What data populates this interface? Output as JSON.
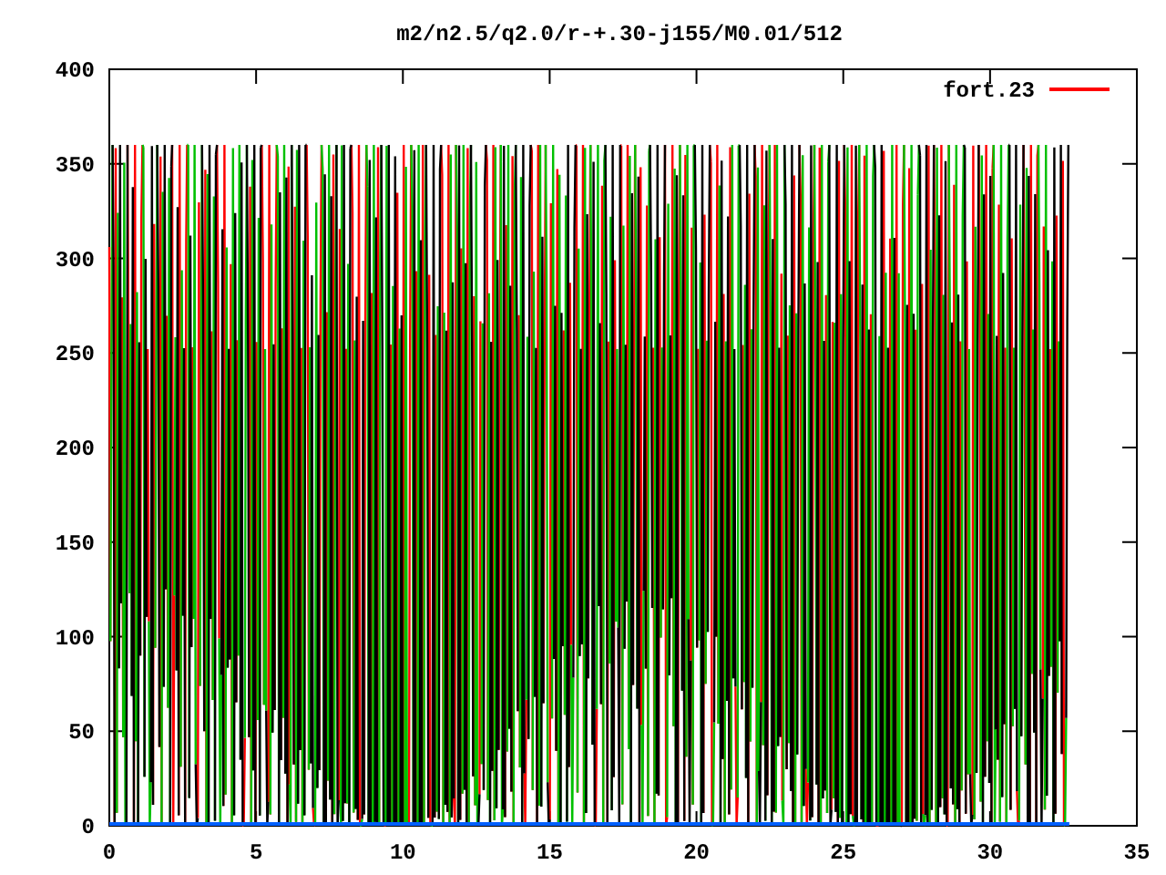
{
  "plot": {
    "title": "m2/n2.5/q2.0/r-+.30-j155/M0.01/512",
    "legend": {
      "label": "fort.23",
      "color": "#ff0000"
    },
    "yticks": [
      "400",
      "350",
      "300",
      "250",
      "200",
      "150",
      "100",
      "50",
      "0"
    ],
    "xticks": [
      "0",
      "5",
      "10",
      "15",
      "20",
      "25",
      "30",
      "35"
    ]
  }
}
